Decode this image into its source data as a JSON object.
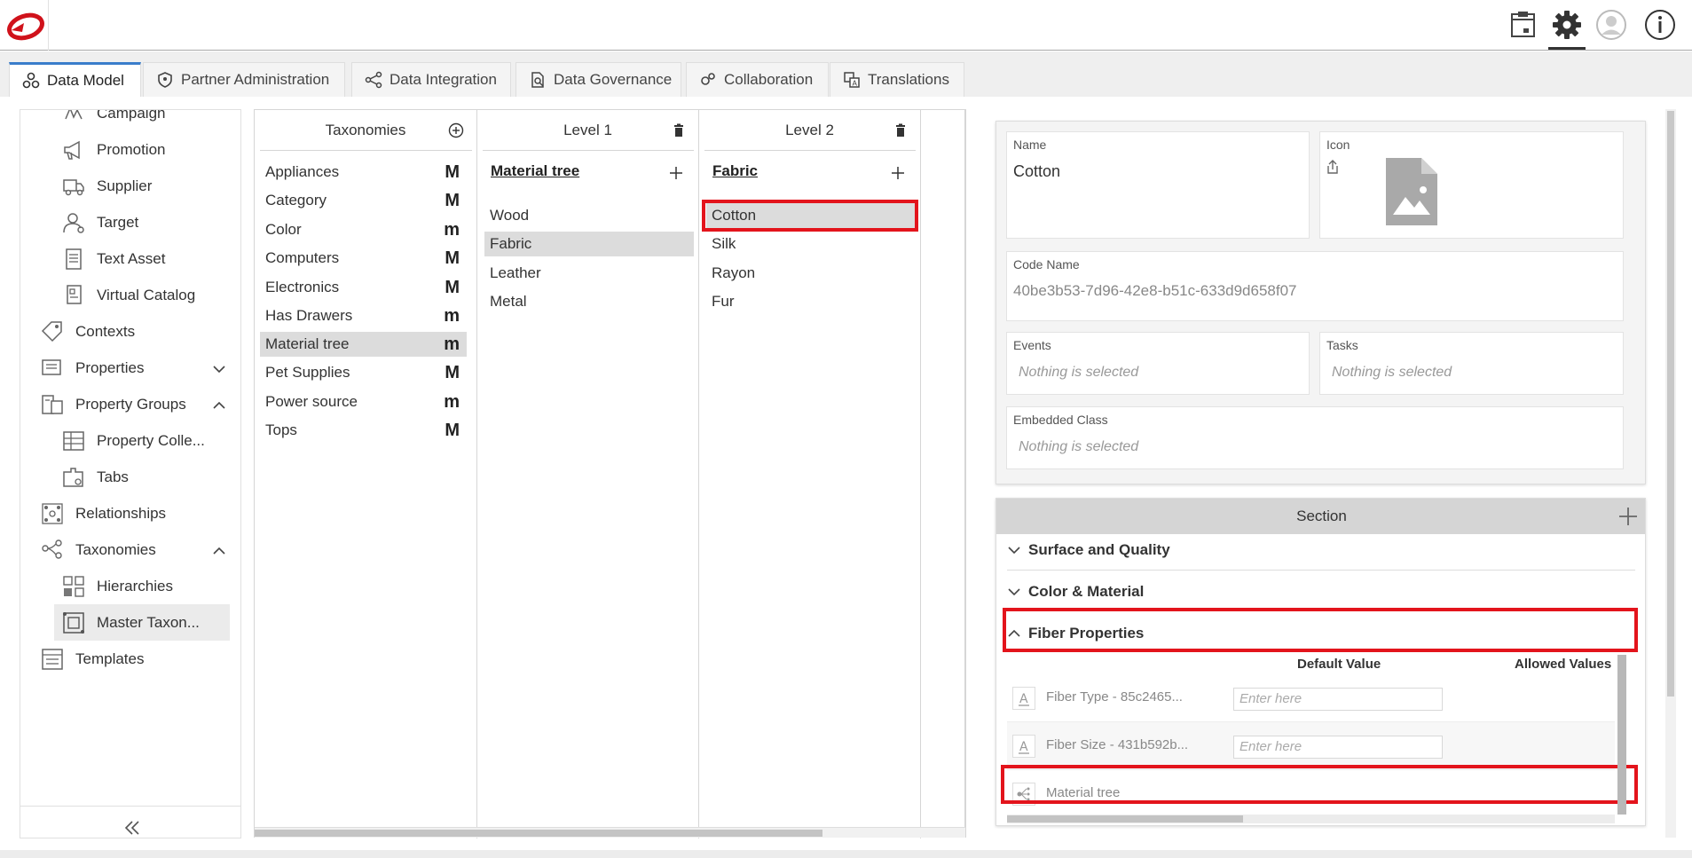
{
  "header": {
    "icons": [
      "logo-icon",
      "archive-icon",
      "gear-icon",
      "user-avatar-icon",
      "info-icon"
    ]
  },
  "tabs": [
    {
      "label": "Data Model",
      "icon": "data-model-icon",
      "active": true
    },
    {
      "label": "Partner Administration",
      "icon": "shield-icon"
    },
    {
      "label": "Data Integration",
      "icon": "integration-icon"
    },
    {
      "label": "Data Governance",
      "icon": "governance-icon"
    },
    {
      "label": "Collaboration",
      "icon": "collaboration-icon"
    },
    {
      "label": "Translations",
      "icon": "translations-icon"
    }
  ],
  "sidebar": {
    "items": [
      {
        "label": "Campaign",
        "icon": "campaign-icon"
      },
      {
        "label": "Promotion",
        "icon": "megaphone-icon"
      },
      {
        "label": "Supplier",
        "icon": "truck-icon"
      },
      {
        "label": "Target",
        "icon": "target-user-icon"
      },
      {
        "label": "Text Asset",
        "icon": "text-document-icon"
      },
      {
        "label": "Virtual Catalog",
        "icon": "catalog-icon"
      },
      {
        "label": "Contexts",
        "icon": "tag-icon"
      },
      {
        "label": "Properties",
        "icon": "properties-icon"
      },
      {
        "label": "Property Groups",
        "icon": "property-groups-icon"
      },
      {
        "label": "Property Colle...",
        "icon": "grid-icon"
      },
      {
        "label": "Tabs",
        "icon": "tabs-icon"
      },
      {
        "label": "Relationships",
        "icon": "relationships-icon"
      },
      {
        "label": "Taxonomies",
        "icon": "taxonomy-icon"
      },
      {
        "label": "Hierarchies",
        "icon": "hierarchies-icon"
      },
      {
        "label": "Master Taxon...",
        "icon": "master-taxonomy-icon"
      },
      {
        "label": "Templates",
        "icon": "templates-icon"
      }
    ]
  },
  "taxonomies": {
    "header": "Taxonomies",
    "items": [
      {
        "label": "Appliances",
        "mark": "M"
      },
      {
        "label": "Category",
        "mark": "M"
      },
      {
        "label": "Color",
        "mark": "m"
      },
      {
        "label": "Computers",
        "mark": "M"
      },
      {
        "label": "Electronics",
        "mark": "M"
      },
      {
        "label": "Has Drawers",
        "mark": "m"
      },
      {
        "label": "Material tree",
        "mark": "m"
      },
      {
        "label": "Pet Supplies",
        "mark": "M"
      },
      {
        "label": "Power source",
        "mark": "m"
      },
      {
        "label": "Tops",
        "mark": "M"
      }
    ]
  },
  "level1": {
    "header": "Level 1",
    "title": "Material tree",
    "items": [
      "Wood",
      "Fabric",
      "Leather",
      "Metal"
    ]
  },
  "level2": {
    "header": "Level 2",
    "title": "Fabric",
    "items": [
      "Cotton",
      "Silk",
      "Rayon",
      "Fur"
    ]
  },
  "details": {
    "name_label": "Name",
    "name_value": "Cotton",
    "icon_label": "Icon",
    "code_label": "Code Name",
    "code_value": "40be3b53-7d96-42e8-b51c-633d9d658f07",
    "events_label": "Events",
    "events_value": "Nothing is selected",
    "tasks_label": "Tasks",
    "tasks_value": "Nothing is selected",
    "embedded_label": "Embedded Class",
    "embedded_value": "Nothing is selected"
  },
  "section": {
    "header": "Section",
    "groups": [
      "Surface and Quality",
      "Color & Material",
      "Fiber Properties"
    ],
    "col_default": "Default Value",
    "col_allowed": "Allowed Values",
    "properties": [
      {
        "name": "Fiber Type - 85c2465...",
        "placeholder": "Enter here",
        "icon": "text-property-icon"
      },
      {
        "name": "Fiber Size - 431b592b...",
        "placeholder": "Enter here",
        "icon": "text-property-icon"
      },
      {
        "name": "Material tree",
        "icon": "taxonomy-property-icon"
      }
    ]
  },
  "colors": {
    "accent": "#3a7ecb",
    "highlight": "#e3141c",
    "brand": "#d0121b"
  }
}
